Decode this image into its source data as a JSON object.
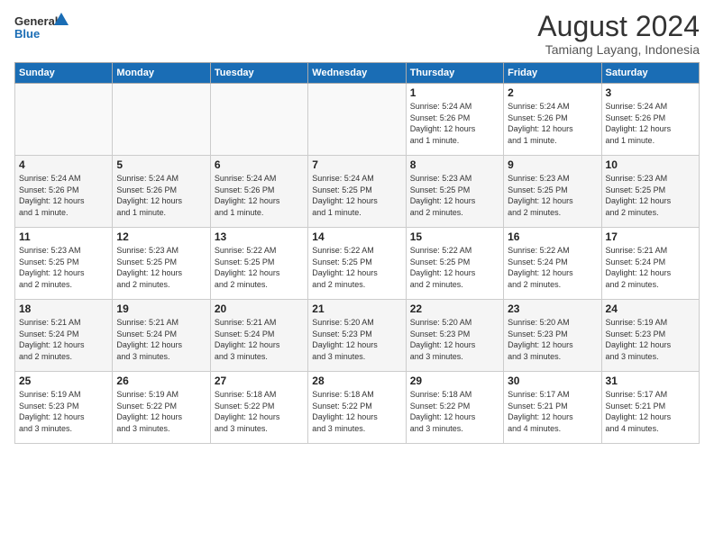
{
  "logo": {
    "line1": "General",
    "line2": "Blue"
  },
  "title": "August 2024",
  "subtitle": "Tamiang Layang, Indonesia",
  "weekdays": [
    "Sunday",
    "Monday",
    "Tuesday",
    "Wednesday",
    "Thursday",
    "Friday",
    "Saturday"
  ],
  "weeks": [
    [
      {
        "day": "",
        "info": ""
      },
      {
        "day": "",
        "info": ""
      },
      {
        "day": "",
        "info": ""
      },
      {
        "day": "",
        "info": ""
      },
      {
        "day": "1",
        "info": "Sunrise: 5:24 AM\nSunset: 5:26 PM\nDaylight: 12 hours\nand 1 minute."
      },
      {
        "day": "2",
        "info": "Sunrise: 5:24 AM\nSunset: 5:26 PM\nDaylight: 12 hours\nand 1 minute."
      },
      {
        "day": "3",
        "info": "Sunrise: 5:24 AM\nSunset: 5:26 PM\nDaylight: 12 hours\nand 1 minute."
      }
    ],
    [
      {
        "day": "4",
        "info": "Sunrise: 5:24 AM\nSunset: 5:26 PM\nDaylight: 12 hours\nand 1 minute."
      },
      {
        "day": "5",
        "info": "Sunrise: 5:24 AM\nSunset: 5:26 PM\nDaylight: 12 hours\nand 1 minute."
      },
      {
        "day": "6",
        "info": "Sunrise: 5:24 AM\nSunset: 5:26 PM\nDaylight: 12 hours\nand 1 minute."
      },
      {
        "day": "7",
        "info": "Sunrise: 5:24 AM\nSunset: 5:25 PM\nDaylight: 12 hours\nand 1 minute."
      },
      {
        "day": "8",
        "info": "Sunrise: 5:23 AM\nSunset: 5:25 PM\nDaylight: 12 hours\nand 2 minutes."
      },
      {
        "day": "9",
        "info": "Sunrise: 5:23 AM\nSunset: 5:25 PM\nDaylight: 12 hours\nand 2 minutes."
      },
      {
        "day": "10",
        "info": "Sunrise: 5:23 AM\nSunset: 5:25 PM\nDaylight: 12 hours\nand 2 minutes."
      }
    ],
    [
      {
        "day": "11",
        "info": "Sunrise: 5:23 AM\nSunset: 5:25 PM\nDaylight: 12 hours\nand 2 minutes."
      },
      {
        "day": "12",
        "info": "Sunrise: 5:23 AM\nSunset: 5:25 PM\nDaylight: 12 hours\nand 2 minutes."
      },
      {
        "day": "13",
        "info": "Sunrise: 5:22 AM\nSunset: 5:25 PM\nDaylight: 12 hours\nand 2 minutes."
      },
      {
        "day": "14",
        "info": "Sunrise: 5:22 AM\nSunset: 5:25 PM\nDaylight: 12 hours\nand 2 minutes."
      },
      {
        "day": "15",
        "info": "Sunrise: 5:22 AM\nSunset: 5:25 PM\nDaylight: 12 hours\nand 2 minutes."
      },
      {
        "day": "16",
        "info": "Sunrise: 5:22 AM\nSunset: 5:24 PM\nDaylight: 12 hours\nand 2 minutes."
      },
      {
        "day": "17",
        "info": "Sunrise: 5:21 AM\nSunset: 5:24 PM\nDaylight: 12 hours\nand 2 minutes."
      }
    ],
    [
      {
        "day": "18",
        "info": "Sunrise: 5:21 AM\nSunset: 5:24 PM\nDaylight: 12 hours\nand 2 minutes."
      },
      {
        "day": "19",
        "info": "Sunrise: 5:21 AM\nSunset: 5:24 PM\nDaylight: 12 hours\nand 3 minutes."
      },
      {
        "day": "20",
        "info": "Sunrise: 5:21 AM\nSunset: 5:24 PM\nDaylight: 12 hours\nand 3 minutes."
      },
      {
        "day": "21",
        "info": "Sunrise: 5:20 AM\nSunset: 5:23 PM\nDaylight: 12 hours\nand 3 minutes."
      },
      {
        "day": "22",
        "info": "Sunrise: 5:20 AM\nSunset: 5:23 PM\nDaylight: 12 hours\nand 3 minutes."
      },
      {
        "day": "23",
        "info": "Sunrise: 5:20 AM\nSunset: 5:23 PM\nDaylight: 12 hours\nand 3 minutes."
      },
      {
        "day": "24",
        "info": "Sunrise: 5:19 AM\nSunset: 5:23 PM\nDaylight: 12 hours\nand 3 minutes."
      }
    ],
    [
      {
        "day": "25",
        "info": "Sunrise: 5:19 AM\nSunset: 5:23 PM\nDaylight: 12 hours\nand 3 minutes."
      },
      {
        "day": "26",
        "info": "Sunrise: 5:19 AM\nSunset: 5:22 PM\nDaylight: 12 hours\nand 3 minutes."
      },
      {
        "day": "27",
        "info": "Sunrise: 5:18 AM\nSunset: 5:22 PM\nDaylight: 12 hours\nand 3 minutes."
      },
      {
        "day": "28",
        "info": "Sunrise: 5:18 AM\nSunset: 5:22 PM\nDaylight: 12 hours\nand 3 minutes."
      },
      {
        "day": "29",
        "info": "Sunrise: 5:18 AM\nSunset: 5:22 PM\nDaylight: 12 hours\nand 3 minutes."
      },
      {
        "day": "30",
        "info": "Sunrise: 5:17 AM\nSunset: 5:21 PM\nDaylight: 12 hours\nand 4 minutes."
      },
      {
        "day": "31",
        "info": "Sunrise: 5:17 AM\nSunset: 5:21 PM\nDaylight: 12 hours\nand 4 minutes."
      }
    ]
  ]
}
